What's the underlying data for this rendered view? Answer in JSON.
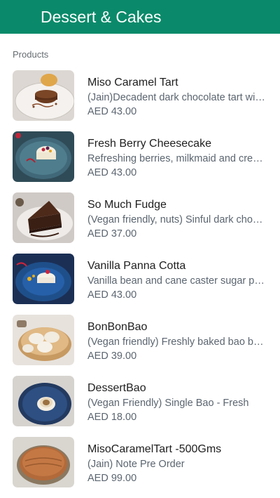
{
  "header": {
    "title": "Dessert & Cakes"
  },
  "section": {
    "label": "Products"
  },
  "products": [
    {
      "name": "Miso Caramel Tart",
      "desc": "(Jain)Decadent dark chocolate tart with miso caramel",
      "price": "AED 43.00",
      "thumb_icon": "tart-image"
    },
    {
      "name": "Fresh Berry Cheesecake",
      "desc": "Refreshing berries, milkmaid and cream cheese",
      "price": "AED 43.00",
      "thumb_icon": "cheesecake-image"
    },
    {
      "name": "So Much Fudge",
      "desc": "(Vegan friendly, nuts) Sinful dark chocolate fudge",
      "price": "AED 37.00",
      "thumb_icon": "fudge-cake-image"
    },
    {
      "name": "Vanilla Panna Cotta",
      "desc": "Vanilla bean and cane caster sugar panna cotta",
      "price": "AED 43.00",
      "thumb_icon": "panna-cotta-image"
    },
    {
      "name": "BonBonBao",
      "desc": "(Vegan friendly) Freshly baked bao buns",
      "price": "AED 39.00",
      "thumb_icon": "bao-basket-image"
    },
    {
      "name": "DessertBao",
      "desc": "(Vegan Friendly) Single Bao - Fresh",
      "price": "AED 18.00",
      "thumb_icon": "bao-plate-image"
    },
    {
      "name": "MisoCaramelTart -500Gms",
      "desc": "(Jain) Note Pre Order",
      "price": "AED 99.00",
      "thumb_icon": "whole-tart-image"
    }
  ],
  "colors": {
    "header_bg": "#0a8a6a",
    "text_primary": "#1e1e1e",
    "text_secondary": "#5b6570"
  }
}
